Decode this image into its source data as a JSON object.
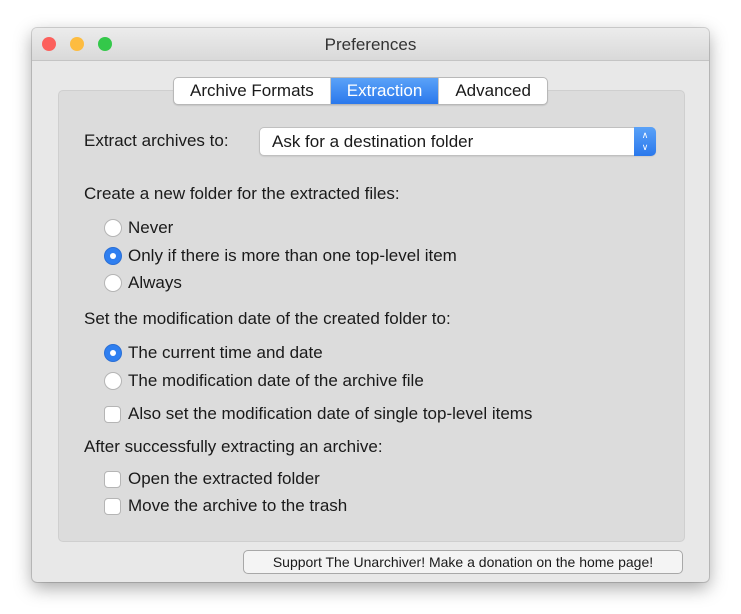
{
  "window": {
    "title": "Preferences"
  },
  "tabs": [
    {
      "label": "Archive Formats"
    },
    {
      "label": "Extraction"
    },
    {
      "label": "Advanced"
    }
  ],
  "extract_to": {
    "label": "Extract archives to:",
    "value": "Ask for a destination folder"
  },
  "create_folder": {
    "heading": "Create a new folder for the extracted files:",
    "options": [
      {
        "label": "Never",
        "selected": false
      },
      {
        "label": "Only if there is more than one top-level item",
        "selected": true
      },
      {
        "label": "Always",
        "selected": false
      }
    ]
  },
  "mod_date": {
    "heading": "Set the modification date of the created folder to:",
    "options": [
      {
        "label": "The current time and date",
        "selected": true
      },
      {
        "label": "The modification date of the archive file",
        "selected": false
      }
    ],
    "also_label": "Also set the modification date of single top-level items",
    "also_checked": false
  },
  "after": {
    "heading": "After successfully extracting an archive:",
    "options": [
      {
        "label": "Open the extracted folder",
        "checked": false
      },
      {
        "label": "Move the archive to the trash",
        "checked": false
      }
    ]
  },
  "donate_button": "Support The Unarchiver! Make a donation on the home page!",
  "colors": {
    "accent": "#2f7ff0",
    "close": "#fc605c",
    "minimize": "#fdbc40",
    "zoom": "#34c84a"
  }
}
